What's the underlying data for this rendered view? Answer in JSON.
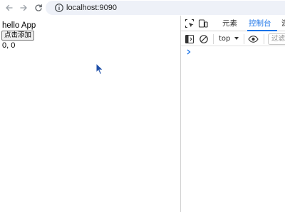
{
  "browser": {
    "url": "localhost:9090",
    "back_icon": "arrow-left-icon",
    "forward_icon": "arrow-right-icon",
    "reload_icon": "reload-icon",
    "site_info_icon": "info-icon"
  },
  "page": {
    "title": "hello App",
    "add_button_label": "点击添加",
    "coords": "0, 0"
  },
  "devtools": {
    "tabs": [
      {
        "label": "元素",
        "active": false
      },
      {
        "label": "控制台",
        "active": true
      },
      {
        "label": "源",
        "active": false
      }
    ],
    "context": "top",
    "filter_placeholder": "过滤",
    "accent": "#1a73e8"
  }
}
